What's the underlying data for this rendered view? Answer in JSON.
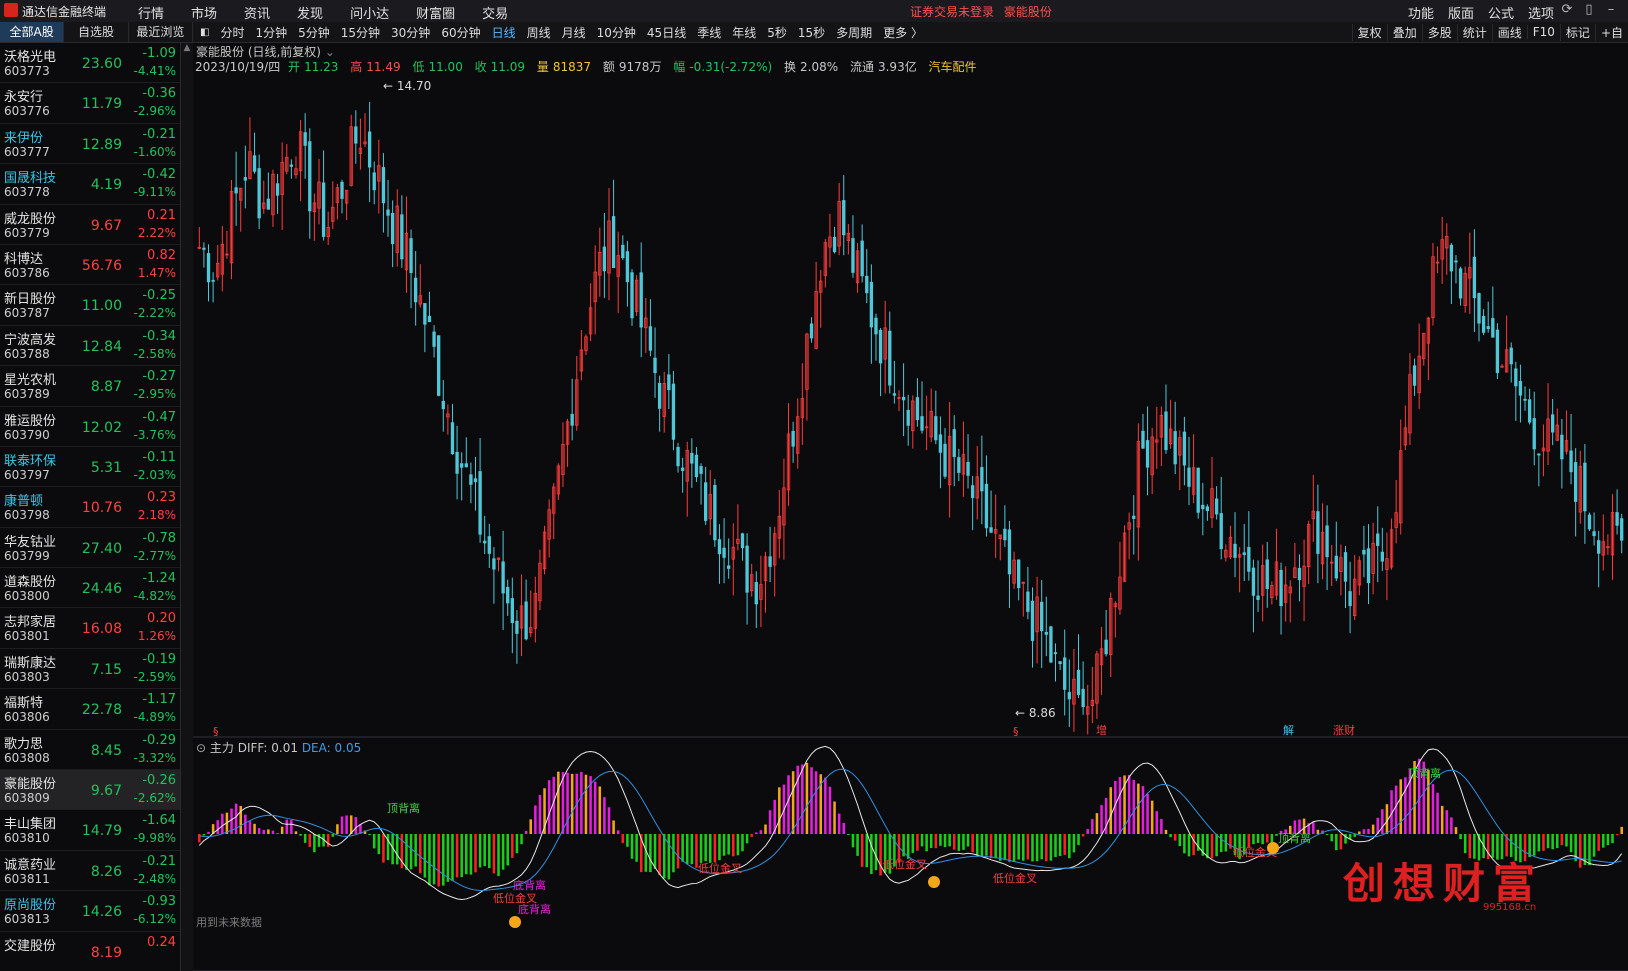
{
  "app": {
    "title": "通达信金融终端"
  },
  "menu": [
    "行情",
    "市场",
    "资讯",
    "发现",
    "问小达",
    "财富圈",
    "交易"
  ],
  "login_warning": "证券交易未登录",
  "current_stock_name": "豪能股份",
  "right_menu": [
    "功能",
    "版面",
    "公式",
    "选项"
  ],
  "list_tabs": [
    "全部A股",
    "自选股",
    "最近浏览"
  ],
  "periods": [
    "分时",
    "1分钟",
    "5分钟",
    "15分钟",
    "30分钟",
    "60分钟",
    "日线",
    "周线",
    "月线",
    "10分钟",
    "45日线",
    "季线",
    "年线",
    "5秒",
    "15秒",
    "多周期",
    "更多 〉"
  ],
  "right_tools": [
    "复权",
    "叠加",
    "多股",
    "统计",
    "画线",
    "F10",
    "标记",
    "+自"
  ],
  "stocks": [
    {
      "name": "沃格光电",
      "code": "603773",
      "price": "23.60",
      "chg": "-1.09",
      "pct": "-4.41%",
      "dir": "dn",
      "hl": false
    },
    {
      "name": "永安行",
      "code": "603776",
      "price": "11.79",
      "chg": "-0.36",
      "pct": "-2.96%",
      "dir": "dn",
      "hl": false
    },
    {
      "name": "来伊份",
      "code": "603777",
      "price": "12.89",
      "chg": "-0.21",
      "pct": "-1.60%",
      "dir": "dn",
      "hl": true
    },
    {
      "name": "国晟科技",
      "code": "603778",
      "price": "4.19",
      "chg": "-0.42",
      "pct": "-9.11%",
      "dir": "dn",
      "hl": true
    },
    {
      "name": "威龙股份",
      "code": "603779",
      "price": "9.67",
      "chg": "0.21",
      "pct": "2.22%",
      "dir": "up",
      "hl": false
    },
    {
      "name": "科博达",
      "code": "603786",
      "price": "56.76",
      "chg": "0.82",
      "pct": "1.47%",
      "dir": "up",
      "hl": false
    },
    {
      "name": "新日股份",
      "code": "603787",
      "price": "11.00",
      "chg": "-0.25",
      "pct": "-2.22%",
      "dir": "dn",
      "hl": false
    },
    {
      "name": "宁波高发",
      "code": "603788",
      "price": "12.84",
      "chg": "-0.34",
      "pct": "-2.58%",
      "dir": "dn",
      "hl": false
    },
    {
      "name": "星光农机",
      "code": "603789",
      "price": "8.87",
      "chg": "-0.27",
      "pct": "-2.95%",
      "dir": "dn",
      "hl": false
    },
    {
      "name": "雅运股份",
      "code": "603790",
      "price": "12.02",
      "chg": "-0.47",
      "pct": "-3.76%",
      "dir": "dn",
      "hl": false
    },
    {
      "name": "联泰环保",
      "code": "603797",
      "price": "5.31",
      "chg": "-0.11",
      "pct": "-2.03%",
      "dir": "dn",
      "hl": true
    },
    {
      "name": "康普顿",
      "code": "603798",
      "price": "10.76",
      "chg": "0.23",
      "pct": "2.18%",
      "dir": "up",
      "hl": true
    },
    {
      "name": "华友钴业",
      "code": "603799",
      "price": "27.40",
      "chg": "-0.78",
      "pct": "-2.77%",
      "dir": "dn",
      "hl": false
    },
    {
      "name": "道森股份",
      "code": "603800",
      "price": "24.46",
      "chg": "-1.24",
      "pct": "-4.82%",
      "dir": "dn",
      "hl": false
    },
    {
      "name": "志邦家居",
      "code": "603801",
      "price": "16.08",
      "chg": "0.20",
      "pct": "1.26%",
      "dir": "up",
      "hl": false
    },
    {
      "name": "瑞斯康达",
      "code": "603803",
      "price": "7.15",
      "chg": "-0.19",
      "pct": "-2.59%",
      "dir": "dn",
      "hl": false
    },
    {
      "name": "福斯特",
      "code": "603806",
      "price": "22.78",
      "chg": "-1.17",
      "pct": "-4.89%",
      "dir": "dn",
      "hl": false
    },
    {
      "name": "歌力思",
      "code": "603808",
      "price": "8.45",
      "chg": "-0.29",
      "pct": "-3.32%",
      "dir": "dn",
      "hl": false
    },
    {
      "name": "豪能股份",
      "code": "603809",
      "price": "9.67",
      "chg": "-0.26",
      "pct": "-2.62%",
      "dir": "dn",
      "hl": false
    },
    {
      "name": "丰山集团",
      "code": "603810",
      "price": "14.79",
      "chg": "-1.64",
      "pct": "-9.98%",
      "dir": "dn",
      "hl": false
    },
    {
      "name": "诚意药业",
      "code": "603811",
      "price": "8.26",
      "chg": "-0.21",
      "pct": "-2.48%",
      "dir": "dn",
      "hl": false
    },
    {
      "name": "原尚股份",
      "code": "603813",
      "price": "14.26",
      "chg": "-0.93",
      "pct": "-6.12%",
      "dir": "dn",
      "hl": true
    },
    {
      "name": "交建股份",
      "code": "",
      "price": "8.19",
      "chg": "0.24",
      "pct": "",
      "dir": "up",
      "hl": false
    }
  ],
  "selected_stock_code": "603809",
  "chart": {
    "title": "豪能股份 (日线,前复权)",
    "date": "2023/10/19/四",
    "open_label": "开",
    "open": "11.23",
    "high_label": "高",
    "high": "11.49",
    "low_label": "低",
    "low": "11.00",
    "close_label": "收",
    "close": "11.09",
    "volume_label": "量",
    "volume": "81837",
    "amount_label": "额",
    "amount": "9178万",
    "amplitude_label": "幅",
    "amplitude": "-0.31(-2.72%)",
    "turnover_label": "换",
    "turnover": "2.08%",
    "float_label": "流通",
    "float_cap": "3.93亿",
    "industry": "汽车配件",
    "max_price_label": "14.70",
    "min_price_label": "8.86",
    "markers": [
      "§",
      "§",
      "增",
      "解",
      "涨财"
    ]
  },
  "macd": {
    "name": "主力",
    "diff_label": "DIFF:",
    "diff": "0.01",
    "dea_label": "DEA:",
    "dea": "0.05",
    "annotations": [
      "顶背离",
      "顶背离",
      "低位金叉",
      "底背离",
      "低位金叉",
      "低位金叉",
      "低位金叉",
      "低位金叉",
      "底背离",
      "顶背离"
    ],
    "note": "用到未来数据"
  },
  "watermark": {
    "text": "创想财富",
    "url": "995168.cn"
  },
  "chart_data": {
    "type": "candlestick",
    "title": "豪能股份 (日线,前复权)",
    "price_range": [
      8.86,
      14.7
    ],
    "close_path": [
      13.2,
      13.0,
      13.5,
      14.0,
      13.6,
      13.9,
      14.2,
      13.7,
      13.4,
      13.8,
      14.3,
      13.9,
      13.5,
      13.1,
      12.6,
      12.0,
      11.4,
      10.9,
      10.4,
      10.0,
      9.7,
      9.8,
      10.6,
      11.5,
      12.4,
      13.0,
      13.3,
      12.8,
      12.3,
      11.8,
      11.4,
      11.0,
      10.7,
      10.5,
      10.2,
      10.1,
      10.6,
      11.4,
      12.3,
      13.2,
      13.5,
      13.0,
      12.6,
      12.2,
      11.9,
      11.6,
      11.4,
      11.2,
      11.0,
      10.7,
      10.4,
      10.0,
      9.8,
      9.5,
      9.1,
      8.9,
      9.0,
      9.8,
      10.6,
      11.3,
      11.6,
      11.3,
      11.0,
      10.8,
      10.6,
      10.4,
      10.2,
      10.0,
      10.1,
      10.4,
      10.6,
      10.3,
      10.0,
      10.1,
      10.3,
      11.0,
      12.0,
      12.8,
      13.2,
      12.9,
      12.6,
      12.3,
      12.0,
      11.7,
      11.4,
      11.3,
      11.1,
      10.7,
      10.5,
      10.4
    ]
  }
}
